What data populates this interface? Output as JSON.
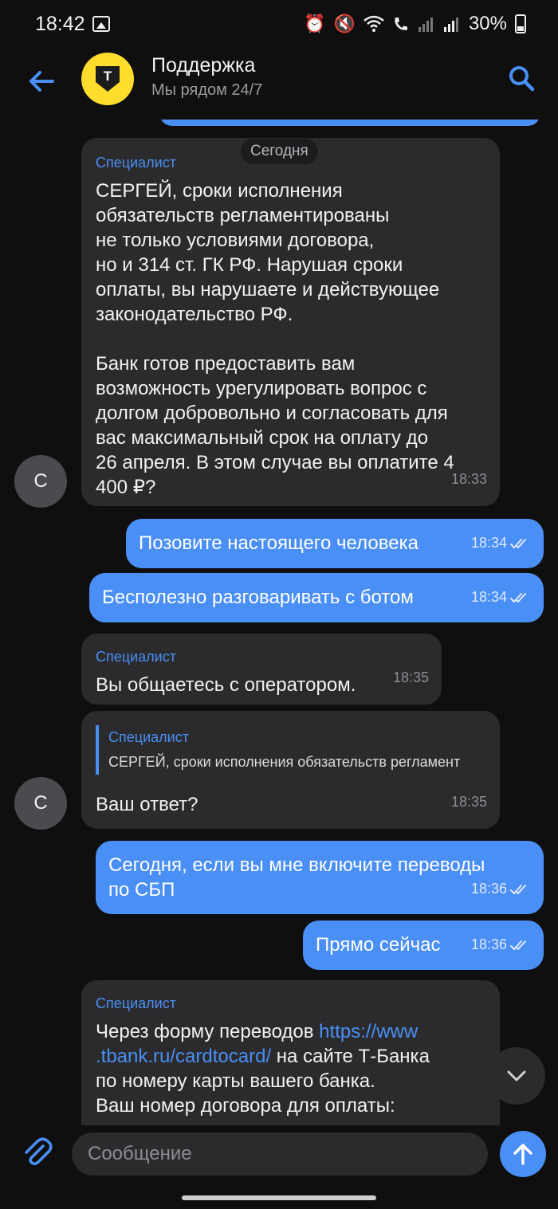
{
  "status_bar": {
    "time": "18:42",
    "battery": "30%",
    "icons": [
      "gallery-icon",
      "alarm-icon",
      "mute-icon",
      "wifi-icon",
      "wifi-call-icon",
      "signal-icon",
      "battery-icon"
    ]
  },
  "header": {
    "title": "Поддержка",
    "subtitle": "Мы рядом 24/7",
    "logo_letter": "Т",
    "logo_color": "#ffdd2d"
  },
  "colors": {
    "accent": "#4a8ff5",
    "incoming_bubble": "#2b2b2d",
    "background": "#0f0f10"
  },
  "chat": {
    "date_label": "Сегодня",
    "messages": [
      {
        "direction": "in",
        "sender": "Специалист",
        "avatar": "С",
        "text": "СЕРГЕЙ, сроки исполнения\nобязательств регламентированы\nне только условиями договора,\nно и 314 ст. ГК РФ. Нарушая сроки\nоплаты, вы нарушаете и действующее\nзаконодательство РФ.\n\nБанк готов предоставить вам\nвозможность урегулировать вопрос с\nдолгом добровольно и согласовать для\nвас максимальный срок на оплату до\n26 апреля. В этом случае вы оплатите 4\n400 ₽?",
        "time": "18:33"
      },
      {
        "direction": "out",
        "text": "Позовите настоящего человека",
        "time": "18:34",
        "status": "read"
      },
      {
        "direction": "out",
        "text": "Бесполезно разговаривать с ботом",
        "time": "18:34",
        "status": "read"
      },
      {
        "direction": "in",
        "sender": "Специалист",
        "text": "Вы общаетесь с оператором.",
        "time": "18:35"
      },
      {
        "direction": "in",
        "avatar": "С",
        "quote": {
          "sender": "Специалист",
          "text": "СЕРГЕЙ, сроки исполнения обязательств регламент"
        },
        "text": "Ваш ответ?",
        "time": "18:35"
      },
      {
        "direction": "out",
        "text": "Сегодня, если вы мне включите переводы\nпо СБП",
        "time": "18:36",
        "status": "read"
      },
      {
        "direction": "out",
        "text": "Прямо сейчас",
        "time": "18:36",
        "status": "read"
      },
      {
        "direction": "in",
        "sender": "Специалист",
        "text_before": "Через форму переводов ",
        "link": "https://www\n.tbank.ru/cardtocard/",
        "text_after": " на сайте Т-Банка\nпо номеру карты вашего банка.\nВаш номер договора для оплаты:"
      }
    ]
  },
  "input": {
    "placeholder": "Сообщение"
  }
}
